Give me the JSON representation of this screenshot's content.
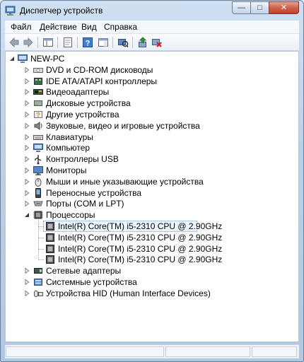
{
  "window": {
    "title": "Диспетчер устройств",
    "buttons": {
      "minimize": "—",
      "maximize": "□",
      "close": "✕"
    }
  },
  "menu": [
    {
      "label": "Файл"
    },
    {
      "label": "Действие"
    },
    {
      "label": "Вид"
    },
    {
      "label": "Справка"
    }
  ],
  "toolbar": [
    {
      "name": "back-icon"
    },
    {
      "name": "forward-icon"
    },
    {
      "name": "console-tree-icon"
    },
    {
      "name": "properties-icon"
    },
    {
      "name": "help-icon"
    },
    {
      "name": "show-hide-icon"
    },
    {
      "name": "scan-hardware-icon"
    },
    {
      "name": "update-driver-icon"
    },
    {
      "name": "uninstall-icon"
    }
  ],
  "tree": {
    "root": {
      "label": "NEW-PC",
      "icon": "computer-icon"
    },
    "categories": [
      {
        "label": "DVD и CD-ROM дисководы",
        "icon": "dvd-drive-icon"
      },
      {
        "label": "IDE ATA/ATAPI контроллеры",
        "icon": "ide-controller-icon"
      },
      {
        "label": "Видеоадаптеры",
        "icon": "display-adapter-icon"
      },
      {
        "label": "Дисковые устройства",
        "icon": "disk-drive-icon"
      },
      {
        "label": "Другие устройства",
        "icon": "other-devices-icon"
      },
      {
        "label": "Звуковые, видео и игровые устройства",
        "icon": "sound-icon"
      },
      {
        "label": "Клавиатуры",
        "icon": "keyboard-icon"
      },
      {
        "label": "Компьютер",
        "icon": "computer-icon"
      },
      {
        "label": "Контроллеры USB",
        "icon": "usb-icon"
      },
      {
        "label": "Мониторы",
        "icon": "monitor-icon"
      },
      {
        "label": "Мыши и иные указывающие устройства",
        "icon": "mouse-icon"
      },
      {
        "label": "Переносные устройства",
        "icon": "portable-device-icon"
      },
      {
        "label": "Порты (COM и LPT)",
        "icon": "port-icon"
      },
      {
        "label": "Процессоры",
        "icon": "processor-icon",
        "expanded": true,
        "children": [
          {
            "label": "Intel(R) Core(TM) i5-2310 CPU @ 2.90GHz",
            "selected": true
          },
          {
            "label": "Intel(R) Core(TM) i5-2310 CPU @ 2.90GHz"
          },
          {
            "label": "Intel(R) Core(TM) i5-2310 CPU @ 2.90GHz"
          },
          {
            "label": "Intel(R) Core(TM) i5-2310 CPU @ 2.90GHz"
          }
        ]
      },
      {
        "label": "Сетевые адаптеры",
        "icon": "network-adapter-icon"
      },
      {
        "label": "Системные устройства",
        "icon": "system-devices-icon"
      },
      {
        "label": "Устройства HID (Human Interface Devices)",
        "icon": "hid-icon"
      }
    ]
  }
}
